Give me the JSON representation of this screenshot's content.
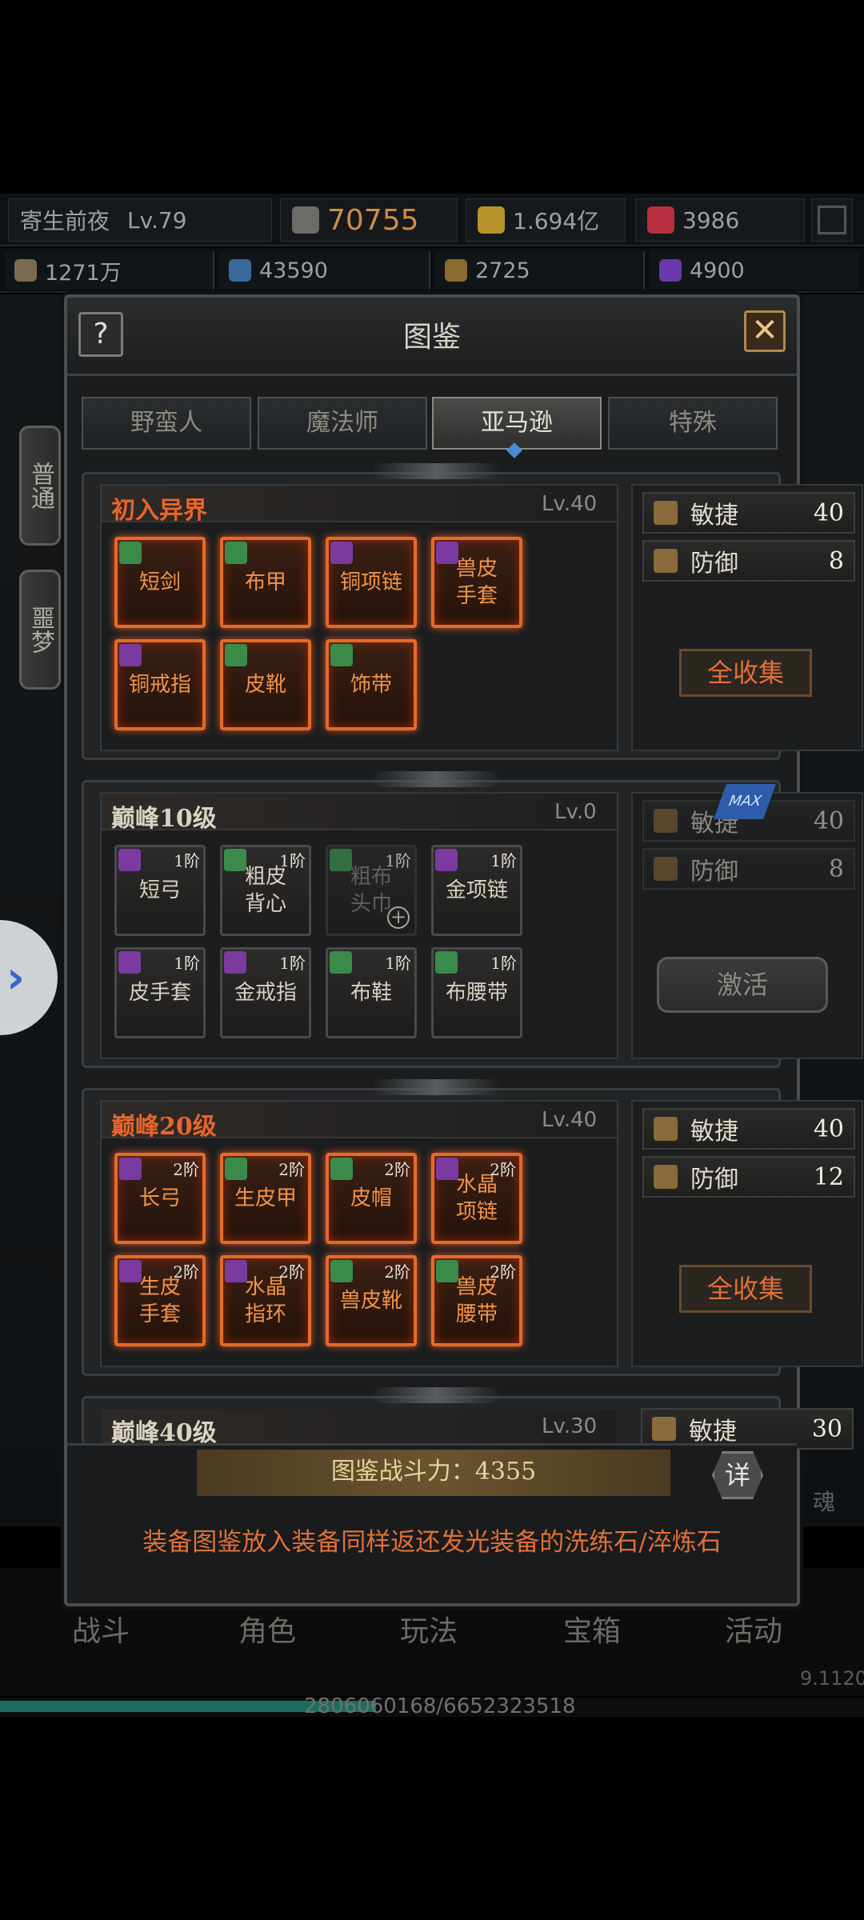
{
  "header": {
    "player_name": "寄生前夜",
    "player_level": "Lv.79",
    "combat_power": "70755",
    "gold": "1.694亿",
    "gems": "3986"
  },
  "resources": [
    "1271万",
    "43590",
    "2725",
    "4900"
  ],
  "modal": {
    "title": "图鉴",
    "help_label": "?",
    "close_label": "✕"
  },
  "side_tabs": [
    "普通",
    "噩梦"
  ],
  "class_tabs": [
    "野蛮人",
    "魔法师",
    "亚马逊",
    "特殊"
  ],
  "active_class_tab": "亚马逊",
  "sections": [
    {
      "name": "初入异界",
      "level": "Lv.40",
      "items": [
        {
          "name": "短剑",
          "badge": "green",
          "tier": ""
        },
        {
          "name": "布甲",
          "badge": "green",
          "tier": ""
        },
        {
          "name": "铜项链",
          "badge": "purple",
          "tier": ""
        },
        {
          "name": "兽皮\n手套",
          "badge": "purple",
          "tier": ""
        },
        {
          "name": "铜戒指",
          "badge": "purple",
          "tier": ""
        },
        {
          "name": "皮靴",
          "badge": "green",
          "tier": ""
        },
        {
          "name": "饰带",
          "badge": "green",
          "tier": ""
        }
      ],
      "stats": [
        {
          "label": "敏捷",
          "value": "40"
        },
        {
          "label": "防御",
          "value": "8"
        }
      ],
      "button": "全收集"
    },
    {
      "name": "巅峰10级",
      "level": "Lv.0",
      "items": [
        {
          "name": "短弓",
          "badge": "purple",
          "tier": "1阶"
        },
        {
          "name": "粗皮\n背心",
          "badge": "green",
          "tier": "1阶"
        },
        {
          "name": "粗布\n头巾",
          "badge": "green",
          "tier": "1阶"
        },
        {
          "name": "金项链",
          "badge": "purple",
          "tier": "1阶"
        },
        {
          "name": "皮手套",
          "badge": "purple",
          "tier": "1阶"
        },
        {
          "name": "金戒指",
          "badge": "purple",
          "tier": "1阶"
        },
        {
          "name": "布鞋",
          "badge": "green",
          "tier": "1阶"
        },
        {
          "name": "布腰带",
          "badge": "green",
          "tier": "1阶"
        }
      ],
      "stats": [
        {
          "label": "敏捷",
          "value": "40"
        },
        {
          "label": "防御",
          "value": "8"
        }
      ],
      "button": "激活",
      "max_tag": "MAX"
    },
    {
      "name": "巅峰20级",
      "level": "Lv.40",
      "items": [
        {
          "name": "长弓",
          "badge": "purple",
          "tier": "2阶"
        },
        {
          "name": "生皮甲",
          "badge": "green",
          "tier": "2阶"
        },
        {
          "name": "皮帽",
          "badge": "green",
          "tier": "2阶"
        },
        {
          "name": "水晶\n项链",
          "badge": "purple",
          "tier": "2阶"
        },
        {
          "name": "生皮\n手套",
          "badge": "purple",
          "tier": "2阶"
        },
        {
          "name": "水晶\n指环",
          "badge": "purple",
          "tier": "2阶"
        },
        {
          "name": "兽皮靴",
          "badge": "green",
          "tier": "2阶"
        },
        {
          "name": "兽皮\n腰带",
          "badge": "green",
          "tier": "2阶"
        }
      ],
      "stats": [
        {
          "label": "敏捷",
          "value": "40"
        },
        {
          "label": "防御",
          "value": "12"
        }
      ],
      "button": "全收集"
    },
    {
      "name": "巅峰40级",
      "level": "Lv.30",
      "stats": [
        {
          "label": "敏捷",
          "value": "30"
        }
      ]
    }
  ],
  "footer": {
    "power_label": "图鉴战斗力：4355",
    "detail_label": "详",
    "note": "装备图鉴放入装备同样返还发光装备的洗练石/淬炼石"
  },
  "bottom_nav": [
    "战斗",
    "角色",
    "玩法",
    "宝箱",
    "活动"
  ],
  "progress_text": "2806060168/6652323518",
  "version": "9.1120",
  "side_label": "魂",
  "colors": {
    "glow_orange": "#e46a2a",
    "badge_green": "#3a8a4a",
    "badge_purple": "#7a3aa0"
  }
}
